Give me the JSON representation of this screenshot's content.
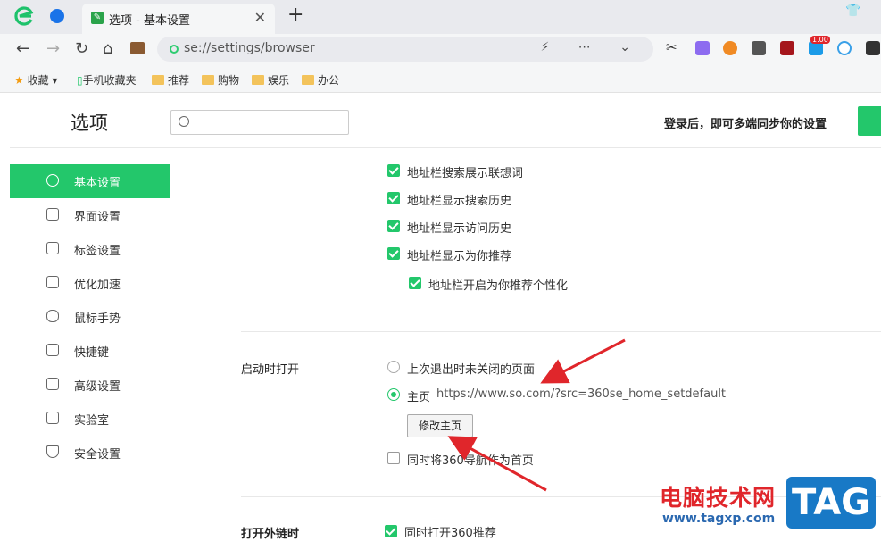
{
  "browser": {
    "tab_title": "选项 - 基本设置",
    "tab_close": "✕",
    "new_tab": "+",
    "address": "se://settings/browser",
    "nav": {
      "back": "←",
      "forward": "→",
      "reload": "↻",
      "home": "⌂"
    },
    "addr_tools": "⚡ ⋯ ⌄"
  },
  "bookmarks": [
    {
      "label": "收藏",
      "icon": "star-icon"
    },
    {
      "label": "手机收藏夹",
      "icon": "phone-icon"
    },
    {
      "label": "推荐",
      "icon": "folder-icon"
    },
    {
      "label": "购物",
      "icon": "folder-icon"
    },
    {
      "label": "娱乐",
      "icon": "folder-icon"
    },
    {
      "label": "办公",
      "icon": "folder-icon"
    }
  ],
  "extension_badge": "1.00",
  "page": {
    "title": "选项",
    "search_placeholder": "",
    "sync_text": "登录后，即可多端同步你的设置"
  },
  "sidebar": [
    {
      "label": "基本设置",
      "icon": "gear-icon",
      "active": true
    },
    {
      "label": "界面设置",
      "icon": "window-icon"
    },
    {
      "label": "标签设置",
      "icon": "tab-icon"
    },
    {
      "label": "优化加速",
      "icon": "bolt-icon"
    },
    {
      "label": "鼠标手势",
      "icon": "mouse-icon"
    },
    {
      "label": "快捷键",
      "icon": "keyboard-icon"
    },
    {
      "label": "高级设置",
      "icon": "wrench-icon"
    },
    {
      "label": "实验室",
      "icon": "flask-icon"
    },
    {
      "label": "安全设置",
      "icon": "shield-icon"
    }
  ],
  "addressbar_options": [
    {
      "label": "地址栏搜索展示联想词",
      "checked": true
    },
    {
      "label": "地址栏显示搜索历史",
      "checked": true
    },
    {
      "label": "地址栏显示访问历史",
      "checked": true
    },
    {
      "label": "地址栏显示为你推荐",
      "checked": true
    },
    {
      "label": "地址栏开启为你推荐个性化",
      "checked": true
    }
  ],
  "startup": {
    "title": "启动时打开",
    "option_last": "上次退出时未关闭的页面",
    "option_home": "主页",
    "home_url": "https://www.so.com/?src=360se_home_setdefault",
    "modify_button": "修改主页",
    "also_360": "同时将360导航作为首页"
  },
  "external": {
    "title": "打开外链时",
    "option": "同时打开360推荐"
  },
  "watermark": {
    "text": "电脑技术网",
    "url": "www.tagxp.com",
    "tag": "TAG"
  },
  "colors": {
    "accent": "#23c76b",
    "arrow": "#e0262b"
  }
}
